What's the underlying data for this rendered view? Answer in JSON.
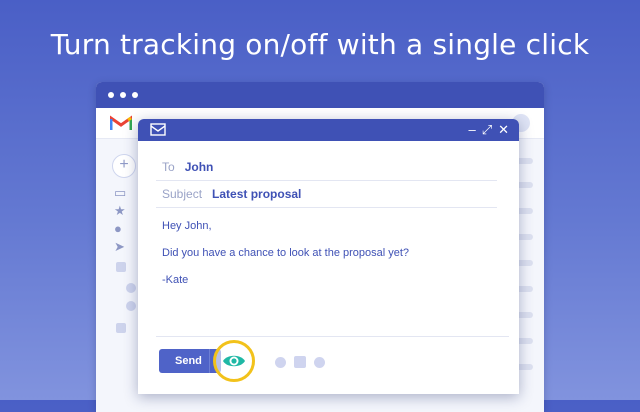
{
  "headline": "Turn tracking on/off with a single click",
  "compose": {
    "to_label": "To",
    "to_value": "John",
    "subject_label": "Subject",
    "subject_value": "Latest proposal",
    "body": [
      "Hey John,",
      "Did you have a chance to look at the proposal yet?",
      "-Kate"
    ],
    "send_label": "Send",
    "header_controls": [
      "–",
      "⤢",
      "✕"
    ]
  },
  "colors": {
    "accent": "#3f51b5",
    "highlight_ring": "#f2c21b",
    "eye": "#1fb8a5"
  },
  "icons": [
    "mail-icon",
    "eye-icon",
    "inbox-icon",
    "star-icon",
    "clock-icon",
    "send-icon"
  ]
}
